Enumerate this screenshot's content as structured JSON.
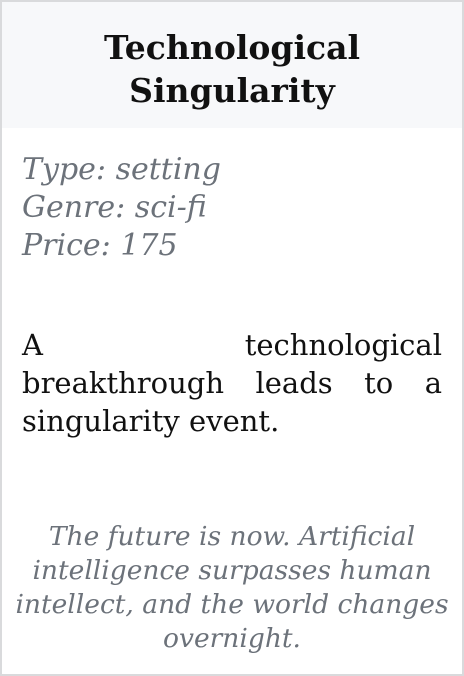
{
  "card": {
    "title": "Technological Singularity",
    "meta": {
      "type_label": "Type:",
      "type_value": "setting",
      "genre_label": "Genre:",
      "genre_value": "sci-fi",
      "price_label": "Price:",
      "price_value": "175"
    },
    "description": "A technological breakthrough leads to a singularity event.",
    "flavor": "The future is now. Artificial intelligence surpasses human intellect, and the world changes overnight."
  },
  "colors": {
    "header_bg": "#f7f8fa",
    "border": "#d9dadc",
    "text": "#111111",
    "muted": "#6c727a"
  }
}
